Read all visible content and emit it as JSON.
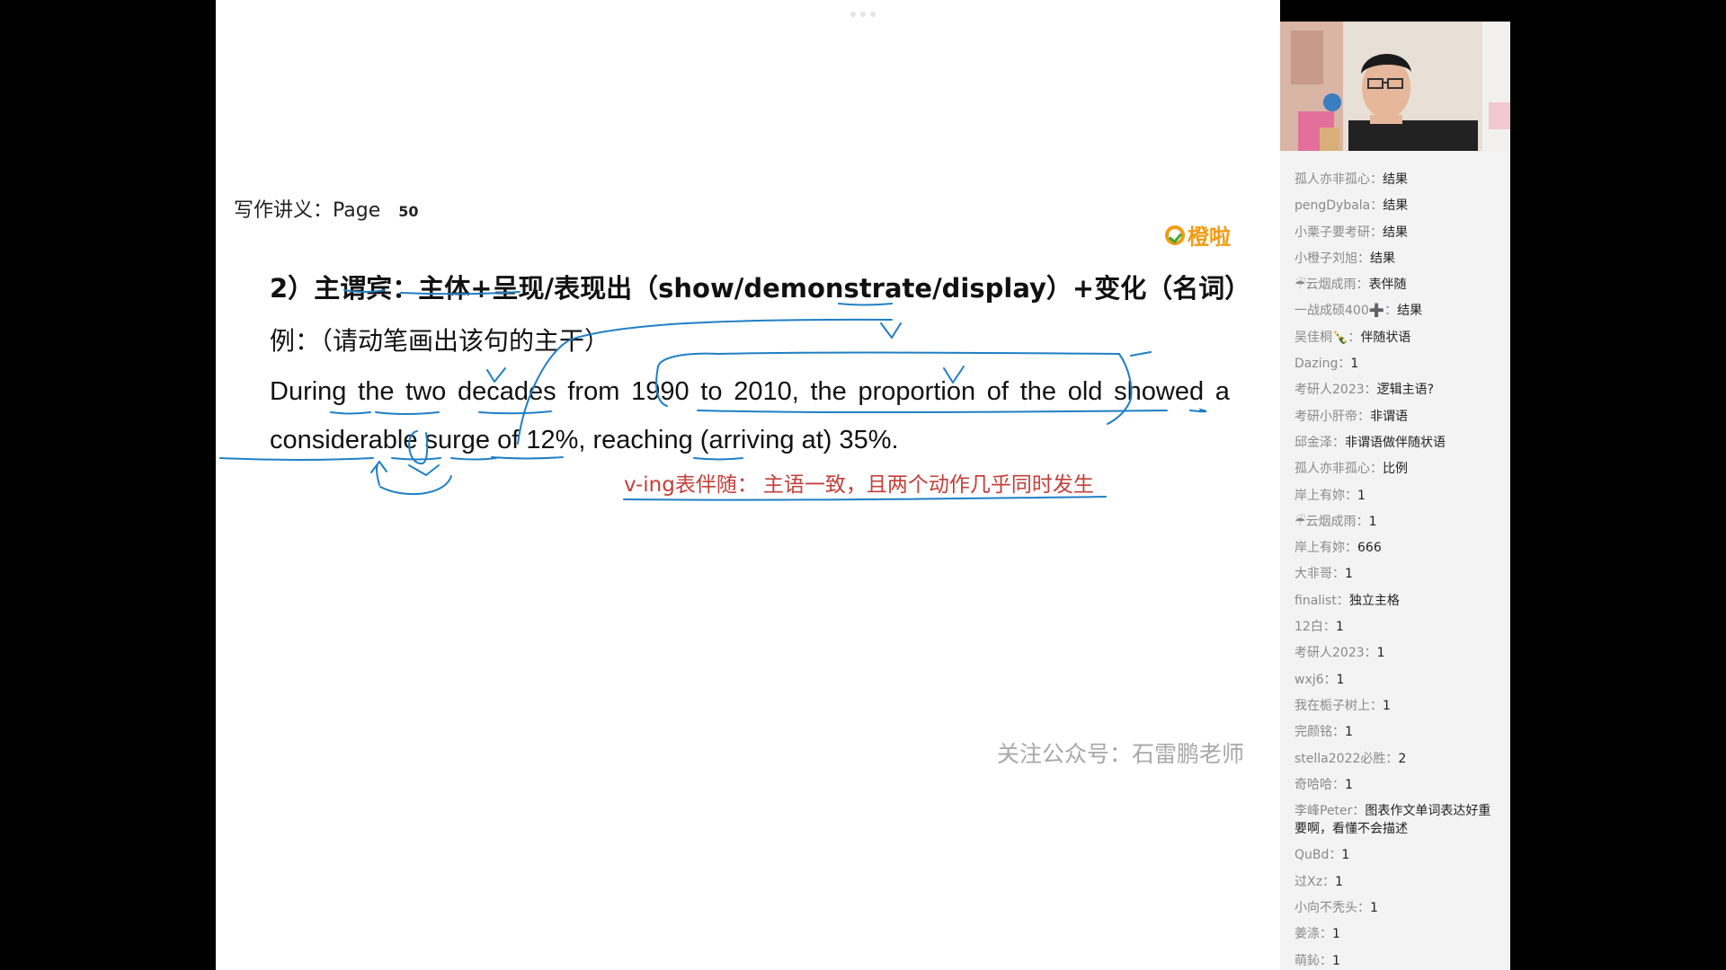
{
  "page_header": {
    "label": "写作讲义：Page",
    "number": "50"
  },
  "logo": {
    "text": "橙啦"
  },
  "heading": {
    "prefix": "2）",
    "part1": "主谓宾：",
    "part2": "主体",
    "part3": "+",
    "part4": "呈现/表现出",
    "part5": "（show/demonstrate/display）+",
    "part6": "变化",
    "part7": "（名词）"
  },
  "example_label": "例：（请动笔画出该句的主干）",
  "sentence": {
    "line1": [
      "During",
      "the",
      "two",
      "decades",
      "from",
      "1990",
      "to",
      "2010,",
      "the",
      "proportion",
      "of",
      "the",
      "old",
      "showed",
      "a"
    ],
    "line2": "considerable surge of 12%, reaching (arriving at) 35%."
  },
  "note": {
    "label": "v-ing表伴随：",
    "text": "主语一致，且两个动作几乎同时发生"
  },
  "footer_note": "关注公众号：石雷鹏老师",
  "colors": {
    "ink": "#1f7fc4",
    "note": "#c2403a",
    "logo": "#f39b12"
  },
  "chat": [
    {
      "user": "孤人亦非孤心：",
      "msg": "结果"
    },
    {
      "user": "pengDybala：",
      "msg": "结果"
    },
    {
      "user": "小栗子要考研：",
      "msg": "结果"
    },
    {
      "user": "小橙子刘旭：",
      "msg": "结果"
    },
    {
      "user": "☔云烟成雨：",
      "msg": "表伴随"
    },
    {
      "user": "一战成硕400➕：",
      "msg": "结果"
    },
    {
      "user": "吴佳桐🍾：",
      "msg": "伴随状语"
    },
    {
      "user": "Dazing：",
      "msg": "1"
    },
    {
      "user": "考研人2023：",
      "msg": "逻辑主语?"
    },
    {
      "user": "考研小肝帝：",
      "msg": "非谓语"
    },
    {
      "user": "邱金泽：",
      "msg": "非谓语做伴随状语"
    },
    {
      "user": "孤人亦非孤心：",
      "msg": "比例"
    },
    {
      "user": "岸上有妳：",
      "msg": "1"
    },
    {
      "user": "☔云烟成雨：",
      "msg": "1"
    },
    {
      "user": "岸上有妳：",
      "msg": "666"
    },
    {
      "user": "大非哥：",
      "msg": "1"
    },
    {
      "user": "finalist：",
      "msg": "独立主格"
    },
    {
      "user": "12白：",
      "msg": "1"
    },
    {
      "user": "考研人2023：",
      "msg": "1"
    },
    {
      "user": "wxj6：",
      "msg": "1"
    },
    {
      "user": "我在栀子树上：",
      "msg": "1"
    },
    {
      "user": "完颜铭：",
      "msg": "1"
    },
    {
      "user": "stella2022必胜：",
      "msg": "2"
    },
    {
      "user": "奇哈哈：",
      "msg": "1"
    },
    {
      "user": "李峰Peter：",
      "msg": "图表作文单词表达好重要啊，看懂不会描述"
    },
    {
      "user": "QuBd：",
      "msg": "1"
    },
    {
      "user": "过Xz：",
      "msg": "1"
    },
    {
      "user": "小向不秃头：",
      "msg": "1"
    },
    {
      "user": "姜涤：",
      "msg": "1"
    },
    {
      "user": "萌鈊：",
      "msg": "1"
    }
  ]
}
